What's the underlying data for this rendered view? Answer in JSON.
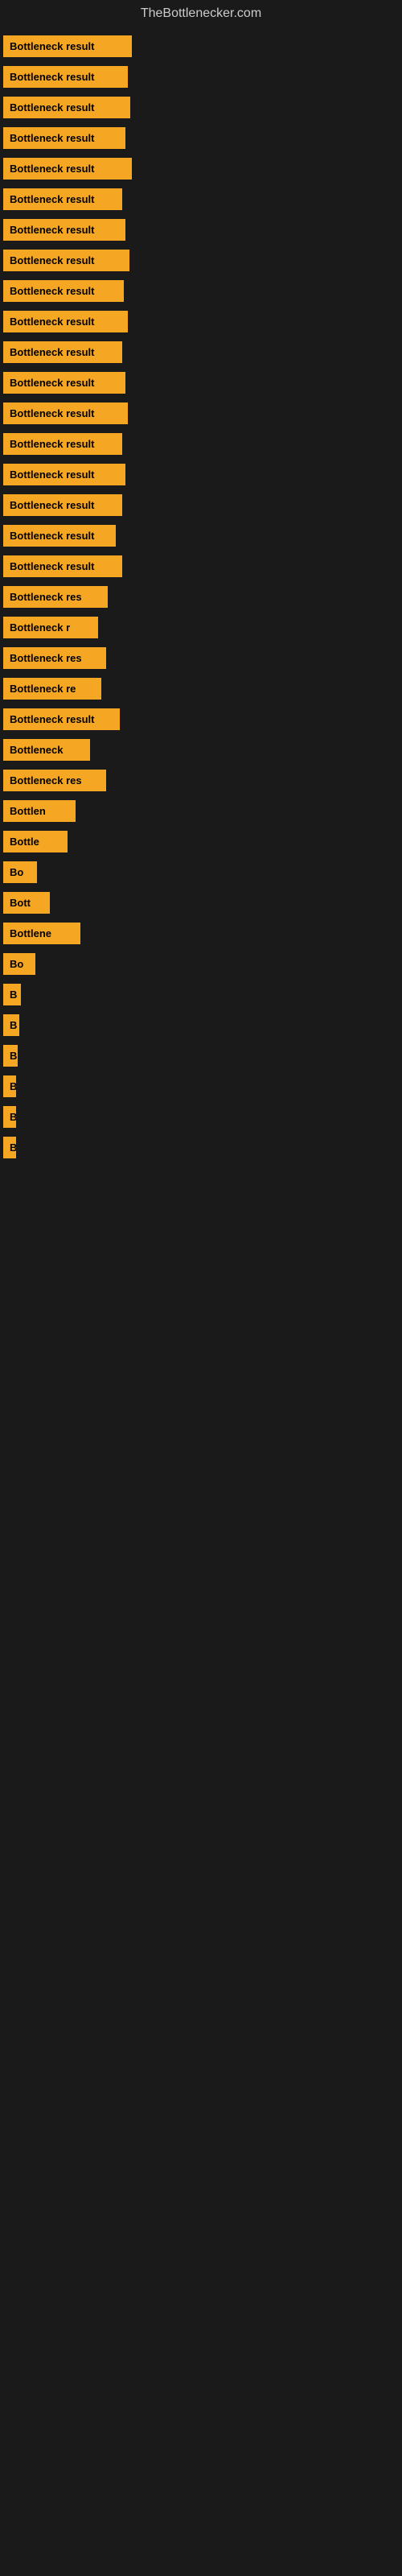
{
  "site": {
    "title": "TheBottlenecker.com"
  },
  "items": [
    {
      "label": "Bottleneck result",
      "width": 160
    },
    {
      "label": "Bottleneck result",
      "width": 155
    },
    {
      "label": "Bottleneck result",
      "width": 158
    },
    {
      "label": "Bottleneck result",
      "width": 152
    },
    {
      "label": "Bottleneck result",
      "width": 160
    },
    {
      "label": "Bottleneck result",
      "width": 148
    },
    {
      "label": "Bottleneck result",
      "width": 152
    },
    {
      "label": "Bottleneck result",
      "width": 157
    },
    {
      "label": "Bottleneck result",
      "width": 150
    },
    {
      "label": "Bottleneck result",
      "width": 155
    },
    {
      "label": "Bottleneck result",
      "width": 148
    },
    {
      "label": "Bottleneck result",
      "width": 152
    },
    {
      "label": "Bottleneck result",
      "width": 155
    },
    {
      "label": "Bottleneck result",
      "width": 148
    },
    {
      "label": "Bottleneck result",
      "width": 152
    },
    {
      "label": "Bottleneck result",
      "width": 148
    },
    {
      "label": "Bottleneck result",
      "width": 140
    },
    {
      "label": "Bottleneck result",
      "width": 148
    },
    {
      "label": "Bottleneck res",
      "width": 130
    },
    {
      "label": "Bottleneck r",
      "width": 118
    },
    {
      "label": "Bottleneck res",
      "width": 128
    },
    {
      "label": "Bottleneck re",
      "width": 122
    },
    {
      "label": "Bottleneck result",
      "width": 145
    },
    {
      "label": "Bottleneck",
      "width": 108
    },
    {
      "label": "Bottleneck res",
      "width": 128
    },
    {
      "label": "Bottlen",
      "width": 90
    },
    {
      "label": "Bottle",
      "width": 80
    },
    {
      "label": "Bo",
      "width": 42
    },
    {
      "label": "Bott",
      "width": 58
    },
    {
      "label": "Bottlene",
      "width": 96
    },
    {
      "label": "Bo",
      "width": 40
    },
    {
      "label": "B",
      "width": 22
    },
    {
      "label": "B",
      "width": 20
    },
    {
      "label": "B",
      "width": 18
    },
    {
      "label": "B",
      "width": 16
    },
    {
      "label": "B",
      "width": 14
    },
    {
      "label": "B",
      "width": 14
    }
  ]
}
